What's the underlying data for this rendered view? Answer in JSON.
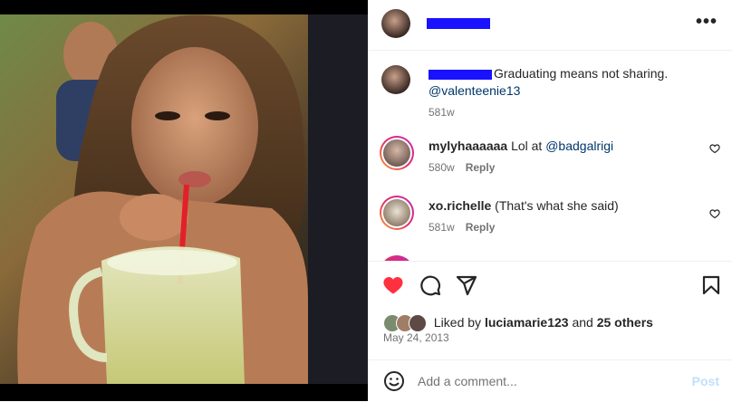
{
  "post": {
    "photo_alt": "Woman drinking from a glass pitcher with a red straw",
    "author_username": "",
    "more_label": "•••"
  },
  "caption": {
    "username": "",
    "text": "Graduating means not sharing.",
    "mention": "@valenteenie13",
    "time": "581w"
  },
  "comments": [
    {
      "username": "mylyhaaaaaa",
      "text": "Lol at ",
      "mention": "@badgalrigi",
      "time": "580w",
      "reply_label": "Reply"
    },
    {
      "username": "xo.richelle",
      "text": "(That's what she said)",
      "mention": "",
      "time": "581w",
      "reply_label": "Reply"
    }
  ],
  "likes": {
    "prefix": "Liked by ",
    "username": "luciamarie123",
    "middle": " and ",
    "others": "25 others"
  },
  "date": "May 24, 2013",
  "add_comment": {
    "placeholder": "Add a comment...",
    "post_label": "Post"
  },
  "colors": {
    "heart_active": "#ff3040",
    "mention": "#00376b",
    "post_disabled": "#c0dffd",
    "redaction": "#1a12ff"
  },
  "icons": [
    "heart-icon",
    "comment-icon",
    "share-icon",
    "bookmark-icon",
    "emoji-icon",
    "more-icon"
  ]
}
